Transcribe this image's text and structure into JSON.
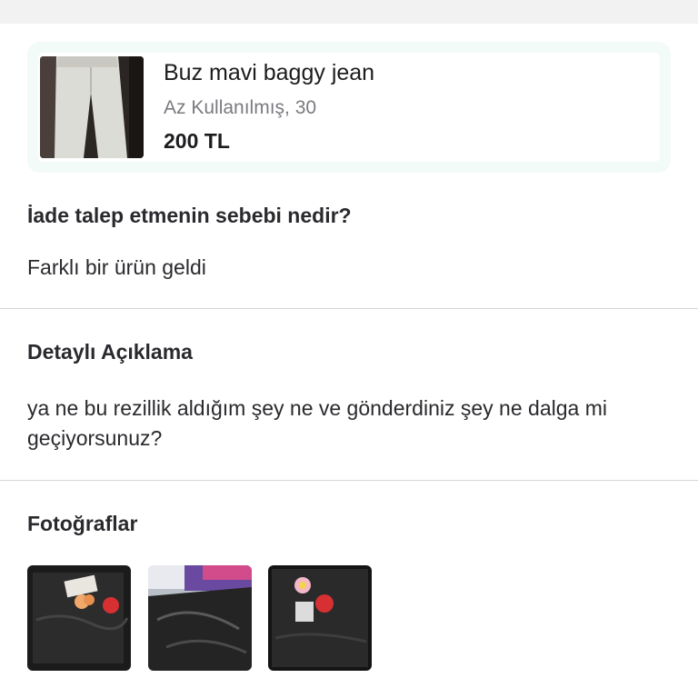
{
  "product": {
    "title": "Buz mavi baggy jean",
    "subtitle": "Az Kullanılmış, 30",
    "price": "200 TL",
    "thumbnail_icon": "jeans-photo"
  },
  "reason": {
    "label": "İade talep etmenin sebebi nedir?",
    "value": "Farklı bir ürün geldi"
  },
  "details": {
    "label": "Detaylı Açıklama",
    "value": "ya ne bu rezillik aldığım şey ne ve gönderdiniz şey ne dalga mi geçiyorsunuz?"
  },
  "photos": {
    "label": "Fotoğraflar",
    "items": [
      "photo-1",
      "photo-2",
      "photo-3"
    ]
  },
  "colors": {
    "card_bg": "#f2fbf7",
    "divider": "#d6d6d8",
    "secondary_text": "#7a7a80"
  }
}
